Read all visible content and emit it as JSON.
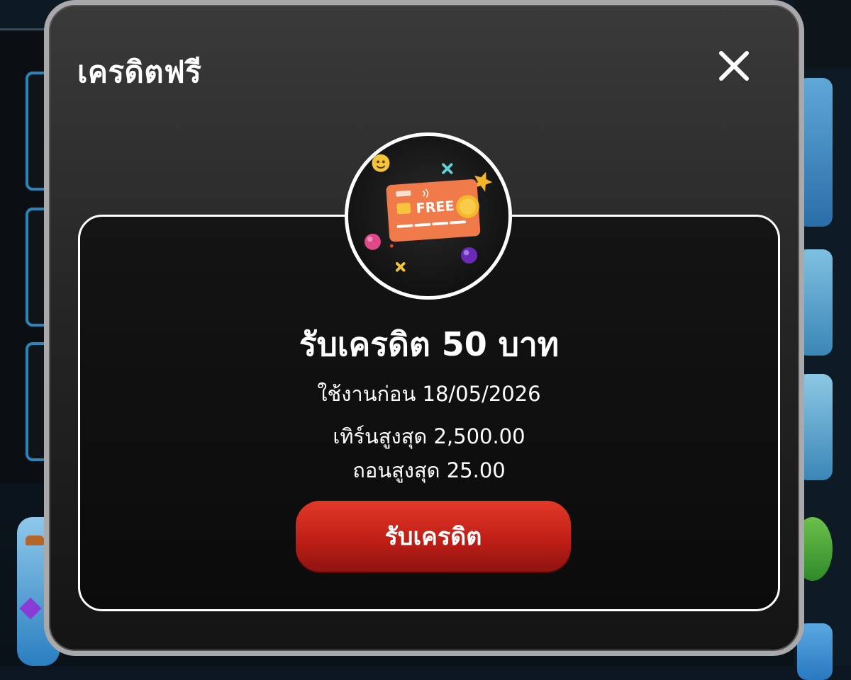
{
  "modal": {
    "title": "เครดิตฟรี",
    "close_icon": "close-icon"
  },
  "promo": {
    "badge_icon": "free-credit-card-icon",
    "card_text": "FREE",
    "title": "รับเครดิต 50 บาท",
    "expiry": "ใช้งานก่อน 18/05/2026",
    "max_turnover": "เทิร์นสูงสุด 2,500.00",
    "max_withdraw": "ถอนสูงสุด 25.00",
    "claim_label": "รับเครดิต"
  },
  "colors": {
    "modal_border": "#a9a9ab",
    "button_red": "#d42a1e",
    "card_orange": "#f07a4a",
    "coin_gold": "#f5b82a"
  }
}
